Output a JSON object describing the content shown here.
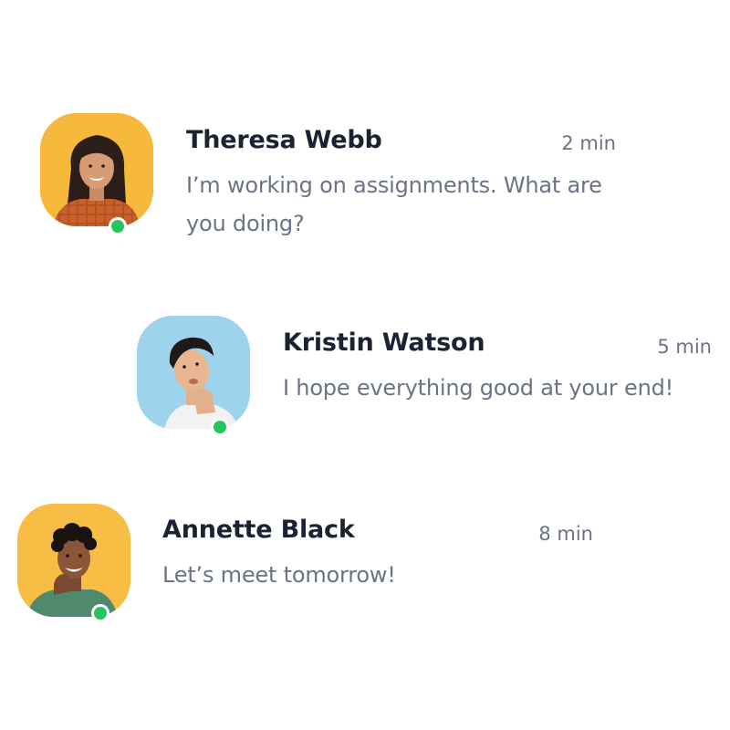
{
  "conversations": [
    {
      "name": "Theresa Webb",
      "time": "2 min",
      "message": "I’m working on assignments. What are you doing?",
      "online": true,
      "avatar_bg": "#f6b93b",
      "avatar_icon": "person-avatar-icon"
    },
    {
      "name": "Kristin Watson",
      "time": "5 min",
      "message": "I hope everything good at your end!",
      "online": true,
      "avatar_bg": "#9ed3ee",
      "avatar_icon": "person-avatar-icon"
    },
    {
      "name": "Annette Black",
      "time": "8 min",
      "message": "Let’s meet tomorrow!",
      "online": true,
      "avatar_bg": "#f8bd45",
      "avatar_icon": "person-avatar-icon"
    }
  ],
  "colors": {
    "online_status": "#22c55e",
    "name_text": "#1c2233",
    "secondary_text": "#6b7386"
  }
}
